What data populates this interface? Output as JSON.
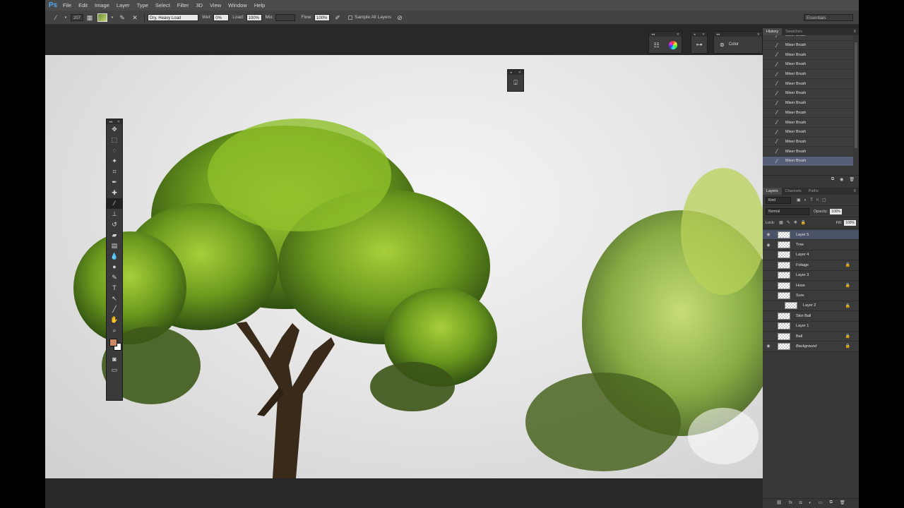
{
  "app": {
    "logo": "Ps"
  },
  "menu": [
    "File",
    "Edit",
    "Image",
    "Layer",
    "Type",
    "Select",
    "Filter",
    "3D",
    "View",
    "Window",
    "Help"
  ],
  "options": {
    "brush_size": "207",
    "preset": "Dry, Heavy Load",
    "wet_label": "Wet:",
    "wet_value": "0%",
    "load_label": "Load:",
    "load_value": "100%",
    "mix_label": "Mix:",
    "mix_value": "",
    "flow_label": "Flow:",
    "flow_value": "100%",
    "sample_all_layers": "Sample All Layers",
    "workspace": "Essentials"
  },
  "floating": {
    "color_label": "Color"
  },
  "history": {
    "tabs": [
      "History",
      "Swatches"
    ],
    "items": [
      "Mixer Brush",
      "Mixer Brush",
      "Mixer Brush",
      "Mixer Brush",
      "Mixer Brush",
      "Mixer Brush",
      "Mixer Brush",
      "Mixer Brush",
      "Mixer Brush",
      "Mixer Brush",
      "Mixer Brush",
      "Mixer Brush",
      "Mixer Brush",
      "Mixer Brush"
    ]
  },
  "layers_panel": {
    "tabs": [
      "Layers",
      "Channels",
      "Paths"
    ],
    "filter_kind": "Kind",
    "blend_mode": "Normal",
    "opacity_label": "Opacity:",
    "opacity_value": "100%",
    "lock_label": "Lock:",
    "fill_label": "Fill:",
    "fill_value": "100%",
    "layers": [
      {
        "name": "Layer 5",
        "visible": true,
        "locked": false
      },
      {
        "name": "Tree",
        "visible": true,
        "locked": false
      },
      {
        "name": "Layer 4",
        "visible": false,
        "locked": false
      },
      {
        "name": "Foliage",
        "visible": false,
        "locked": true
      },
      {
        "name": "Layer 3",
        "visible": false,
        "locked": false
      },
      {
        "name": "Hose",
        "visible": false,
        "locked": true
      },
      {
        "name": "Sure",
        "visible": false,
        "locked": false
      },
      {
        "name": "Layer 2",
        "visible": false,
        "locked": true
      },
      {
        "name": "Skin Ball",
        "visible": false,
        "locked": false
      },
      {
        "name": "Layer 1",
        "visible": false,
        "locked": false
      },
      {
        "name": "Ball",
        "visible": false,
        "locked": true
      },
      {
        "name": "Background",
        "visible": true,
        "locked": true
      }
    ]
  },
  "colors": {
    "foreground": "#c98a62",
    "background": "#ffffff",
    "accent": "#4fa8f0"
  }
}
